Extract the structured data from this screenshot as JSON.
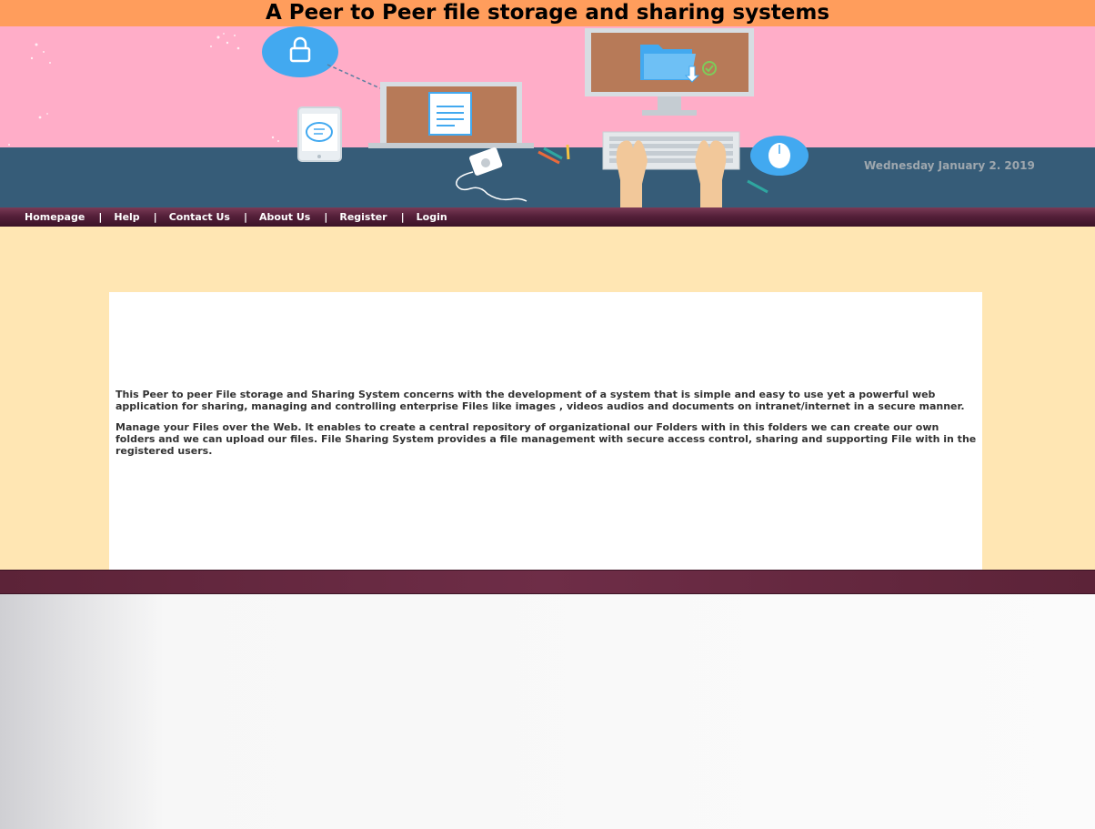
{
  "header": {
    "title": "A Peer to Peer file storage and sharing systems"
  },
  "banner": {
    "date": "Wednesday January 2. 2019",
    "colors": {
      "sky": "#ffadc8",
      "desk": "#365c78",
      "screen": "#b77a58",
      "accent_blue": "#42a9f0"
    },
    "icons": [
      "lock-icon",
      "document-icon",
      "folder-icon",
      "chat-icon",
      "mouse-icon",
      "keyboard-icon",
      "music-player-icon",
      "hands-icon",
      "pencil-icon"
    ]
  },
  "nav": {
    "items": [
      {
        "label": "Homepage"
      },
      {
        "label": "Help"
      },
      {
        "label": "Contact Us"
      },
      {
        "label": "About Us"
      },
      {
        "label": "Register"
      },
      {
        "label": "Login"
      }
    ],
    "separator": "|"
  },
  "content": {
    "paragraph1": "This Peer to peer File storage and Sharing System concerns with the development of a system that is simple and easy to use yet a powerful web application for sharing, managing and controlling enterprise Files like images , videos audios and documents on intranet/internet in a secure manner.",
    "paragraph2": "Manage your Files over the Web. It enables to create a central repository of organizational our Folders with in this folders we can create our own folders and we can upload our files. File Sharing System provides a file management with secure access control, sharing and supporting File with in the registered users."
  },
  "colors": {
    "title_bar": "#ff9d5c",
    "nav_bar": "#55203a",
    "main_bg": "#ffe6b3",
    "footer_bar": "#6e2d47"
  }
}
